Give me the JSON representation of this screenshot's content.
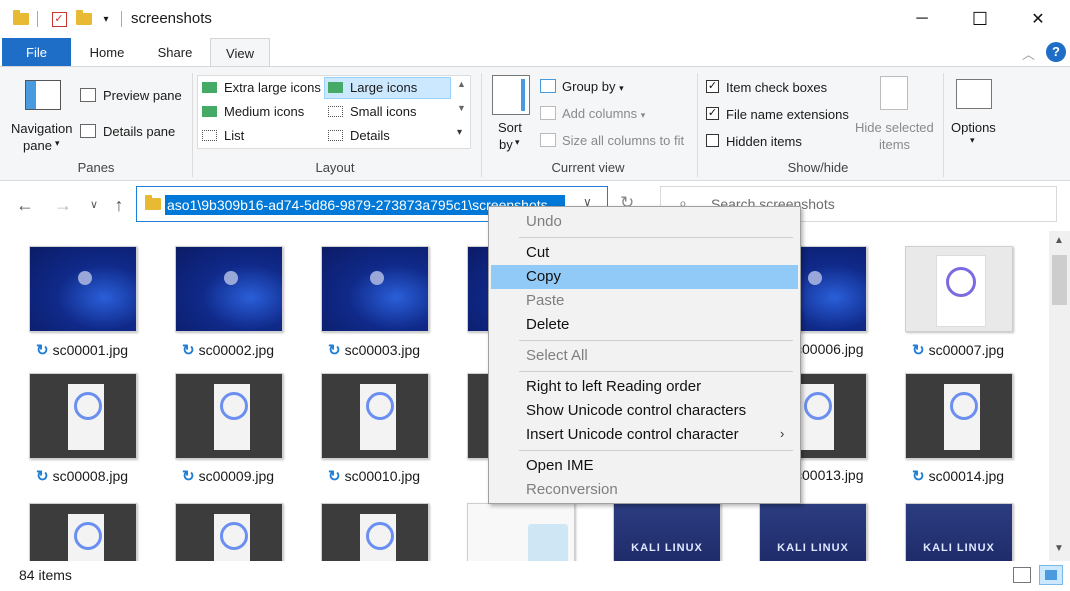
{
  "window": {
    "title": "screenshots",
    "minimize": "─",
    "maximize": "☐",
    "close": "✕"
  },
  "tabs": [
    "File",
    "Home",
    "Share",
    "View"
  ],
  "ribbon": {
    "panes": {
      "navigation_pane": "Navigation",
      "navigation_pane2": "pane",
      "preview_pane": "Preview pane",
      "details_pane": "Details pane",
      "group": "Panes"
    },
    "layout": {
      "items": [
        "Extra large icons",
        "Large icons",
        "Medium icons",
        "Small icons",
        "List",
        "Details"
      ],
      "selected": "Large icons",
      "group": "Layout"
    },
    "current_view": {
      "sort_by": "Sort",
      "sort_by2": "by",
      "group_by": "Group by",
      "add_columns": "Add columns",
      "size_columns": "Size all columns to fit",
      "group": "Current view"
    },
    "show_hide": {
      "item_check_boxes": "Item check boxes",
      "file_name_extensions": "File name extensions",
      "hidden_items": "Hidden items",
      "hide_selected": "Hide selected",
      "hide_selected2": "items",
      "options": "Options",
      "group": "Show/hide"
    },
    "checks": {
      "item_check_boxes": true,
      "file_name_extensions": true,
      "hidden_items": false
    }
  },
  "address": {
    "selected_text": "aso1\\9b309b16-ad74-5d86-9879-273873a795c1\\screenshots"
  },
  "search": {
    "placeholder": "Search screenshots"
  },
  "files": [
    {
      "name": "sc00001.jpg",
      "kind": "blue"
    },
    {
      "name": "sc00002.jpg",
      "kind": "blue"
    },
    {
      "name": "sc00003.jpg",
      "kind": "blue"
    },
    {
      "name": "sc00006.jpg",
      "kind": "blue"
    },
    {
      "name": "sc00007.jpg",
      "kind": "gray"
    },
    {
      "name": "sc00008.jpg",
      "kind": "dark"
    },
    {
      "name": "sc00009.jpg",
      "kind": "dark"
    },
    {
      "name": "sc00010.jpg",
      "kind": "dark"
    },
    {
      "name": "sc00013.jpg",
      "kind": "dark"
    },
    {
      "name": "sc00014.jpg",
      "kind": "dark"
    }
  ],
  "kali_label": "KALI LINUX",
  "status": {
    "count": "84 items"
  },
  "context_menu": {
    "items": [
      {
        "label": "Undo",
        "disabled": true
      },
      {
        "label": "Cut",
        "disabled": false
      },
      {
        "label": "Copy",
        "disabled": false,
        "highlighted": true
      },
      {
        "label": "Paste",
        "disabled": true
      },
      {
        "label": "Delete",
        "disabled": false
      },
      {
        "label": "Select All",
        "disabled": true
      },
      {
        "label": "Right to left Reading order",
        "disabled": false
      },
      {
        "label": "Show Unicode control characters",
        "disabled": false
      },
      {
        "label": "Insert Unicode control character",
        "disabled": false,
        "submenu": true
      },
      {
        "label": "Open IME",
        "disabled": false
      },
      {
        "label": "Reconversion",
        "disabled": true
      }
    ]
  }
}
